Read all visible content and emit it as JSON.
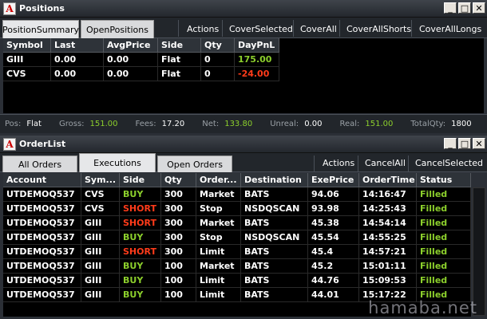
{
  "positions": {
    "title": "Positions",
    "tabs": [
      "PositionSummary",
      "OpenPositions"
    ],
    "toolbar": [
      "Actions",
      "CoverSelected",
      "CoverAll",
      "CoverAllShorts",
      "CoverAllLongs"
    ],
    "columns": [
      "Symbol",
      "Last",
      "AvgPrice",
      "Side",
      "Qty",
      "DayPnL"
    ],
    "rows": [
      {
        "symbol": "GIII",
        "last": "0.00",
        "avg": "0.00",
        "side": "Flat",
        "qty": "0",
        "pnl": "175.00"
      },
      {
        "symbol": "CVS",
        "last": "0.00",
        "avg": "0.00",
        "side": "Flat",
        "qty": "0",
        "pnl": "-24.00"
      }
    ],
    "status": {
      "pos_label": "Pos:",
      "pos": "Flat",
      "gross_label": "Gross:",
      "gross": "151.00",
      "fees_label": "Fees:",
      "fees": "17.20",
      "net_label": "Net:",
      "net": "133.80",
      "unreal_label": "Unreal:",
      "unreal": "0.00",
      "real_label": "Real:",
      "real": "151.00",
      "totalqty_label": "TotalQty:",
      "totalqty": "1800"
    }
  },
  "orders": {
    "title": "OrderList",
    "tabs": [
      "All Orders",
      "Executions",
      "Open Orders"
    ],
    "toolbar": [
      "Actions",
      "CancelAll",
      "CancelSelected"
    ],
    "columns": [
      "Account",
      "Sym...",
      "Side",
      "Qty",
      "Order...",
      "Destination",
      "ExePrice",
      "OrderTime",
      "Status"
    ],
    "rows": [
      {
        "account": "UTDEMOQ537",
        "sym": "CVS",
        "side": "BUY",
        "qty": "300",
        "type": "Market",
        "dest": "BATS",
        "price": "94.06",
        "time": "14:16:47",
        "status": "Filled"
      },
      {
        "account": "UTDEMOQ537",
        "sym": "CVS",
        "side": "SHORT",
        "qty": "300",
        "type": "Stop",
        "dest": "NSDQSCAN",
        "price": "93.98",
        "time": "14:25:43",
        "status": "Filled"
      },
      {
        "account": "UTDEMOQ537",
        "sym": "GIII",
        "side": "SHORT",
        "qty": "300",
        "type": "Market",
        "dest": "BATS",
        "price": "45.38",
        "time": "14:54:14",
        "status": "Filled"
      },
      {
        "account": "UTDEMOQ537",
        "sym": "GIII",
        "side": "BUY",
        "qty": "300",
        "type": "Stop",
        "dest": "NSDQSCAN",
        "price": "45.54",
        "time": "14:55:25",
        "status": "Filled"
      },
      {
        "account": "UTDEMOQ537",
        "sym": "GIII",
        "side": "SHORT",
        "qty": "300",
        "type": "Limit",
        "dest": "BATS",
        "price": "45.4",
        "time": "14:57:21",
        "status": "Filled"
      },
      {
        "account": "UTDEMOQ537",
        "sym": "GIII",
        "side": "BUY",
        "qty": "100",
        "type": "Market",
        "dest": "BATS",
        "price": "45.2",
        "time": "15:01:11",
        "status": "Filled"
      },
      {
        "account": "UTDEMOQ537",
        "sym": "GIII",
        "side": "BUY",
        "qty": "100",
        "type": "Limit",
        "dest": "BATS",
        "price": "44.76",
        "time": "15:09:53",
        "status": "Filled"
      },
      {
        "account": "UTDEMOQ537",
        "sym": "GIII",
        "side": "BUY",
        "qty": "100",
        "type": "Limit",
        "dest": "BATS",
        "price": "44.01",
        "time": "15:17:22",
        "status": "Filled"
      }
    ]
  },
  "window_buttons": {
    "minimize": "_",
    "maximize": "□",
    "close": "✕"
  },
  "app_icon": "A",
  "watermark": "hamaba.net",
  "colors": {
    "buy": "#8ccf2c",
    "short": "#ff3b1a",
    "filled": "#8ccf2c",
    "pnl_positive": "#8ccf2c",
    "pnl_negative": "#ff3b1a"
  }
}
